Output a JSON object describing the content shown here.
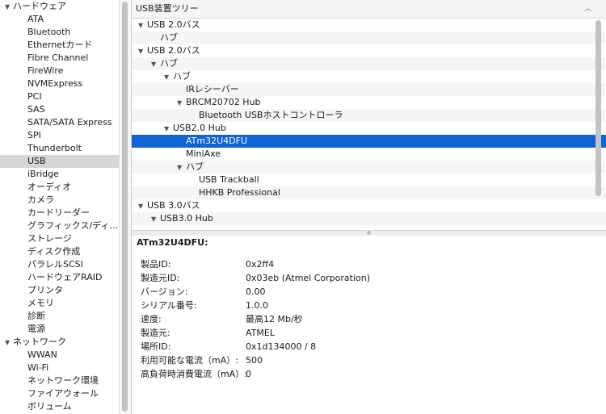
{
  "sidebar": {
    "hardware_label": "ハードウェア",
    "network_label": "ネットワーク",
    "items": [
      {
        "label": "ATA"
      },
      {
        "label": "Bluetooth"
      },
      {
        "label": "Ethernetカード"
      },
      {
        "label": "Fibre Channel"
      },
      {
        "label": "FireWire"
      },
      {
        "label": "NVMExpress"
      },
      {
        "label": "PCI"
      },
      {
        "label": "SAS"
      },
      {
        "label": "SATA/SATA Express"
      },
      {
        "label": "SPI"
      },
      {
        "label": "Thunderbolt"
      },
      {
        "label": "USB"
      },
      {
        "label": "iBridge"
      },
      {
        "label": "オーディオ"
      },
      {
        "label": "カメラ"
      },
      {
        "label": "カードリーダー"
      },
      {
        "label": "グラフィックス/ディ…"
      },
      {
        "label": "ストレージ"
      },
      {
        "label": "ディスク作成"
      },
      {
        "label": "パラレルSCSI"
      },
      {
        "label": "ハードウェアRAID"
      },
      {
        "label": "プリンタ"
      },
      {
        "label": "メモリ"
      },
      {
        "label": "診断"
      },
      {
        "label": "電源"
      }
    ],
    "network_items": [
      {
        "label": "WWAN"
      },
      {
        "label": "Wi-Fi"
      },
      {
        "label": "ネットワーク環境"
      },
      {
        "label": "ファイアウォール"
      },
      {
        "label": "ボリューム"
      }
    ],
    "selected": "USB"
  },
  "tree": {
    "header": "USB装置ツリー",
    "rows": [
      {
        "label": "USB 2.0バス",
        "expanded": true
      },
      {
        "label": "ハブ"
      },
      {
        "label": "USB 2.0バス",
        "expanded": true
      },
      {
        "label": "ハブ",
        "expanded": true
      },
      {
        "label": "ハブ",
        "expanded": true
      },
      {
        "label": "IRレシーバー"
      },
      {
        "label": "BRCM20702 Hub",
        "expanded": true
      },
      {
        "label": "Bluetooth USBホストコントローラ"
      },
      {
        "label": "USB2.0 Hub",
        "expanded": true
      },
      {
        "label": "ATm32U4DFU"
      },
      {
        "label": "MiniAxe"
      },
      {
        "label": "ハブ",
        "expanded": true
      },
      {
        "label": "USB Trackball"
      },
      {
        "label": "HHKB Professional"
      },
      {
        "label": "USB 3.0バス",
        "expanded": true
      },
      {
        "label": "USB3.0 Hub",
        "expanded": true
      }
    ],
    "selected": "ATm32U4DFU"
  },
  "detail": {
    "title": "ATm32U4DFU:",
    "rows": [
      {
        "key": "製品ID:",
        "value": "0x2ff4"
      },
      {
        "key": "製造元ID:",
        "value": "0x03eb  (Atmel Corporation)"
      },
      {
        "key": "バージョン:",
        "value": "0.00"
      },
      {
        "key": "シリアル番号:",
        "value": "1.0.0"
      },
      {
        "key": "速度:",
        "value": "最高12 Mb/秒"
      },
      {
        "key": "製造元:",
        "value": "ATMEL"
      },
      {
        "key": "場所ID:",
        "value": "0x1d134000 / 8"
      },
      {
        "key": "利用可能な電流（mA）:",
        "value": "500"
      },
      {
        "key": "高負荷時消費電流（mA）:",
        "value": "0"
      }
    ]
  },
  "colors": {
    "selection": "#0f63d6",
    "sidebar_selected": "#d6d6d6"
  },
  "icons": {
    "expanded": "disclosure-triangle-down-icon",
    "sort": "chevron-up-icon"
  }
}
